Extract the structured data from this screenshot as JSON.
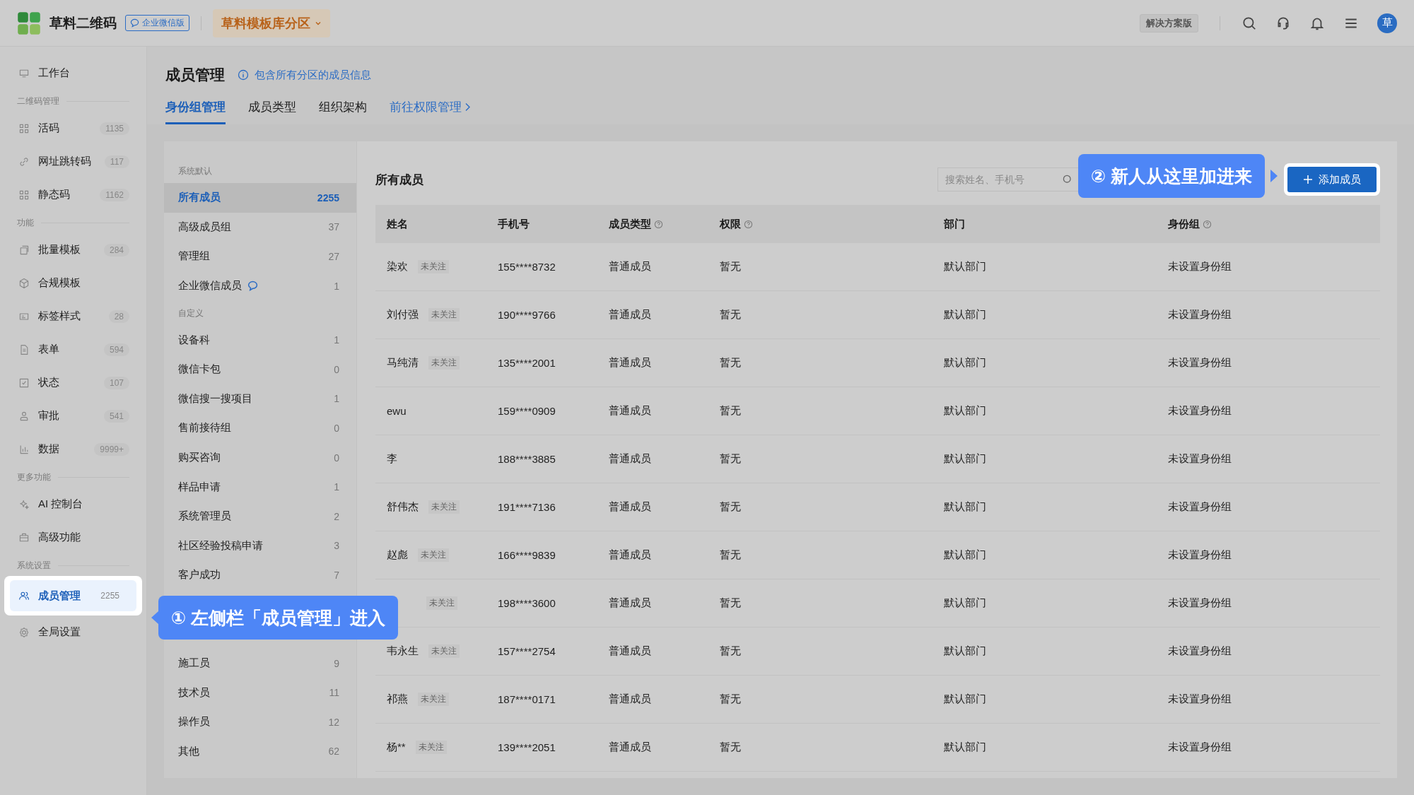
{
  "top_bar": {
    "brand": "草料二维码",
    "edition_badge": "企业微信版",
    "workspace": "草料模板库分区",
    "plan_badge": "解决方案版",
    "avatar": "草"
  },
  "sidebar": [
    {
      "items": [
        {
          "label": "工作台",
          "selected": false
        }
      ]
    },
    {
      "heading": "二维码管理",
      "items": [
        {
          "label": "活码",
          "count": "1135",
          "selected": false
        },
        {
          "label": "网址跳转码",
          "count": "117",
          "selected": false
        },
        {
          "label": "静态码",
          "count": "1162",
          "selected": false
        }
      ]
    },
    {
      "heading": "功能",
      "items": [
        {
          "label": "批量模板",
          "count": "284",
          "selected": false
        },
        {
          "label": "合规模板",
          "selected": false
        },
        {
          "label": "标签样式",
          "count": "28",
          "selected": false
        },
        {
          "label": "表单",
          "count": "594",
          "selected": false
        },
        {
          "label": "状态",
          "count": "107",
          "selected": false
        },
        {
          "label": "审批",
          "count": "541",
          "selected": false
        },
        {
          "label": "数据",
          "count": "9999+",
          "selected": false
        }
      ]
    },
    {
      "heading": "更多功能",
      "items": [
        {
          "label": "AI 控制台",
          "selected": false
        },
        {
          "label": "高级功能",
          "selected": false
        }
      ]
    },
    {
      "heading": "系统设置",
      "items": [
        {
          "label": "成员管理",
          "count": "2255",
          "selected": true
        },
        {
          "label": "全局设置",
          "selected": false
        }
      ]
    }
  ],
  "page": {
    "title": "成员管理",
    "info": "包含所有分区的成员信息",
    "tabs": [
      {
        "label": "身份组管理",
        "selected": true,
        "kind": "tab"
      },
      {
        "label": "成员类型",
        "selected": false,
        "kind": "tab"
      },
      {
        "label": "组织架构",
        "selected": false,
        "kind": "tab"
      },
      {
        "label": "前往权限管理",
        "selected": false,
        "kind": "link"
      }
    ]
  },
  "groups": [
    {
      "heading": "系统默认",
      "items": [
        {
          "label": "所有成员",
          "count": "2255",
          "selected": true,
          "kind": "plain"
        },
        {
          "label": "高级成员组",
          "count": "37",
          "selected": false,
          "kind": "plain"
        },
        {
          "label": "管理组",
          "count": "27",
          "selected": false,
          "kind": "plain"
        },
        {
          "label": "企业微信成员",
          "count": "1",
          "selected": false,
          "kind": "wechat"
        }
      ]
    },
    {
      "heading": "自定义",
      "items": [
        {
          "label": "设备科",
          "count": "1",
          "selected": false,
          "kind": "plain"
        },
        {
          "label": "微信卡包",
          "count": "0",
          "selected": false,
          "kind": "plain"
        },
        {
          "label": "微信搜一搜项目",
          "count": "1",
          "selected": false,
          "kind": "plain"
        },
        {
          "label": "售前接待组",
          "count": "0",
          "selected": false,
          "kind": "plain"
        },
        {
          "label": "购买咨询",
          "count": "0",
          "selected": false,
          "kind": "plain"
        },
        {
          "label": "样品申请",
          "count": "1",
          "selected": false,
          "kind": "plain"
        },
        {
          "label": "系统管理员",
          "count": "2",
          "selected": false,
          "kind": "plain"
        },
        {
          "label": "社区经验投稿申请",
          "count": "3",
          "selected": false,
          "kind": "plain"
        },
        {
          "label": "客户成功",
          "count": "7",
          "selected": false,
          "kind": "plain"
        },
        {
          "label": "施工员",
          "count": "9",
          "selected": false,
          "kind": "plain"
        },
        {
          "label": "技术员",
          "count": "11",
          "selected": false,
          "kind": "plain"
        },
        {
          "label": "操作员",
          "count": "12",
          "selected": false,
          "kind": "plain"
        },
        {
          "label": "其他",
          "count": "62",
          "selected": false,
          "kind": "plain"
        }
      ]
    }
  ],
  "members": {
    "title": "所有成员",
    "search": {
      "placeholder": "搜索姓名、手机号"
    },
    "add_button": "添加成员",
    "columns": [
      {
        "label": "姓名",
        "help": false
      },
      {
        "label": "手机号",
        "help": false
      },
      {
        "label": "成员类型",
        "help": true
      },
      {
        "label": "权限",
        "help": true
      },
      {
        "label": "部门",
        "help": false
      },
      {
        "label": "身份组",
        "help": true
      }
    ],
    "rows": [
      {
        "name": "染欢",
        "tag": "未关注",
        "phone": "155****8732",
        "type": "普通成员",
        "permission": "暂无",
        "department": "默认部门",
        "group": "未设置身份组"
      },
      {
        "name": "刘付强",
        "tag": "未关注",
        "phone": "190****9766",
        "type": "普通成员",
        "permission": "暂无",
        "department": "默认部门",
        "group": "未设置身份组"
      },
      {
        "name": "马纯清",
        "tag": "未关注",
        "phone": "135****2001",
        "type": "普通成员",
        "permission": "暂无",
        "department": "默认部门",
        "group": "未设置身份组"
      },
      {
        "name": "ewu",
        "phone": "159****0909",
        "type": "普通成员",
        "permission": "暂无",
        "department": "默认部门",
        "group": "未设置身份组"
      },
      {
        "name": "李",
        "phone": "188****3885",
        "type": "普通成员",
        "permission": "暂无",
        "department": "默认部门",
        "group": "未设置身份组"
      },
      {
        "name": "舒伟杰",
        "tag": "未关注",
        "phone": "191****7136",
        "type": "普通成员",
        "permission": "暂无",
        "department": "默认部门",
        "group": "未设置身份组"
      },
      {
        "name": "赵彪",
        "tag": "未关注",
        "phone": "166****9839",
        "type": "普通成员",
        "permission": "暂无",
        "department": "默认部门",
        "group": "未设置身份组"
      },
      {
        "tag": "未关注",
        "phone": "198****3600",
        "type": "普通成员",
        "permission": "暂无",
        "department": "默认部门",
        "group": "未设置身份组"
      },
      {
        "name": "韦永生",
        "tag": "未关注",
        "phone": "157****2754",
        "type": "普通成员",
        "permission": "暂无",
        "department": "默认部门",
        "group": "未设置身份组"
      },
      {
        "name": "祁燕",
        "tag": "未关注",
        "phone": "187****0171",
        "type": "普通成员",
        "permission": "暂无",
        "department": "默认部门",
        "group": "未设置身份组"
      },
      {
        "name": "杨**",
        "tag": "未关注",
        "phone": "139****2051",
        "type": "普通成员",
        "permission": "暂无",
        "department": "默认部门",
        "group": "未设置身份组"
      }
    ]
  },
  "callouts": [
    {
      "text": "① 左侧栏「成员管理」进入"
    },
    {
      "text": "② 新人从这里加进来"
    }
  ]
}
